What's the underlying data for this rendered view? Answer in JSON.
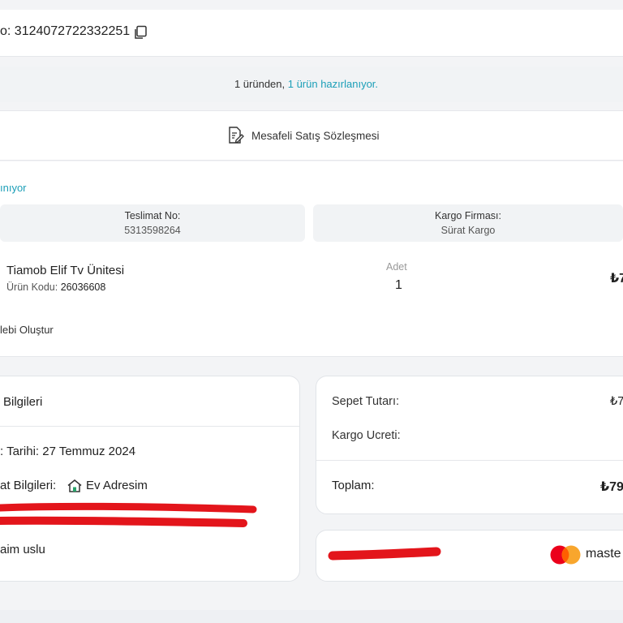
{
  "order": {
    "number_text": "o: 3124072722332251"
  },
  "banner": {
    "prefix": "1 üründen, ",
    "highlight": "1 ürün hazırlanıyor."
  },
  "contract": {
    "label": "Mesafeli Satış Sözleşmesi"
  },
  "shipment": {
    "status": "ınıyor",
    "delivery_no_label": "Teslimat No:",
    "delivery_no_value": "5313598264",
    "carrier_label": "Kargo Firması:",
    "carrier_value": "Sürat Kargo",
    "product_name": "Tiamob Elif Tv Ünitesi",
    "product_code_label": "Ürün Kodu: ",
    "product_code_value": "26036608",
    "qty_label": "Adet",
    "qty_value": "1",
    "price_visible": "₺7",
    "return_link": "lebi Oluştur"
  },
  "address": {
    "title": "Bilgileri",
    "order_date": ": Tarihi: 27 Temmuz 2024",
    "delivery_label": "at Bilgileri: ",
    "delivery_value": "Ev Adresim",
    "line1": "",
    "line2": "",
    "name": "aim uslu"
  },
  "summary": {
    "basket_label": "Sepet Tutarı:",
    "basket_value": "₺7",
    "shipping_label": "Kargo Ucreti:",
    "shipping_value": "",
    "total_label": "Toplam:",
    "total_value": "₺79"
  },
  "payment": {
    "brand_text": "maste",
    "icon": "mastercard-logo"
  },
  "colors": {
    "accent": "#1c9fb8",
    "redaction": "#e3151b",
    "mc_red": "#eb001b",
    "mc_orange": "#f79e1b"
  }
}
